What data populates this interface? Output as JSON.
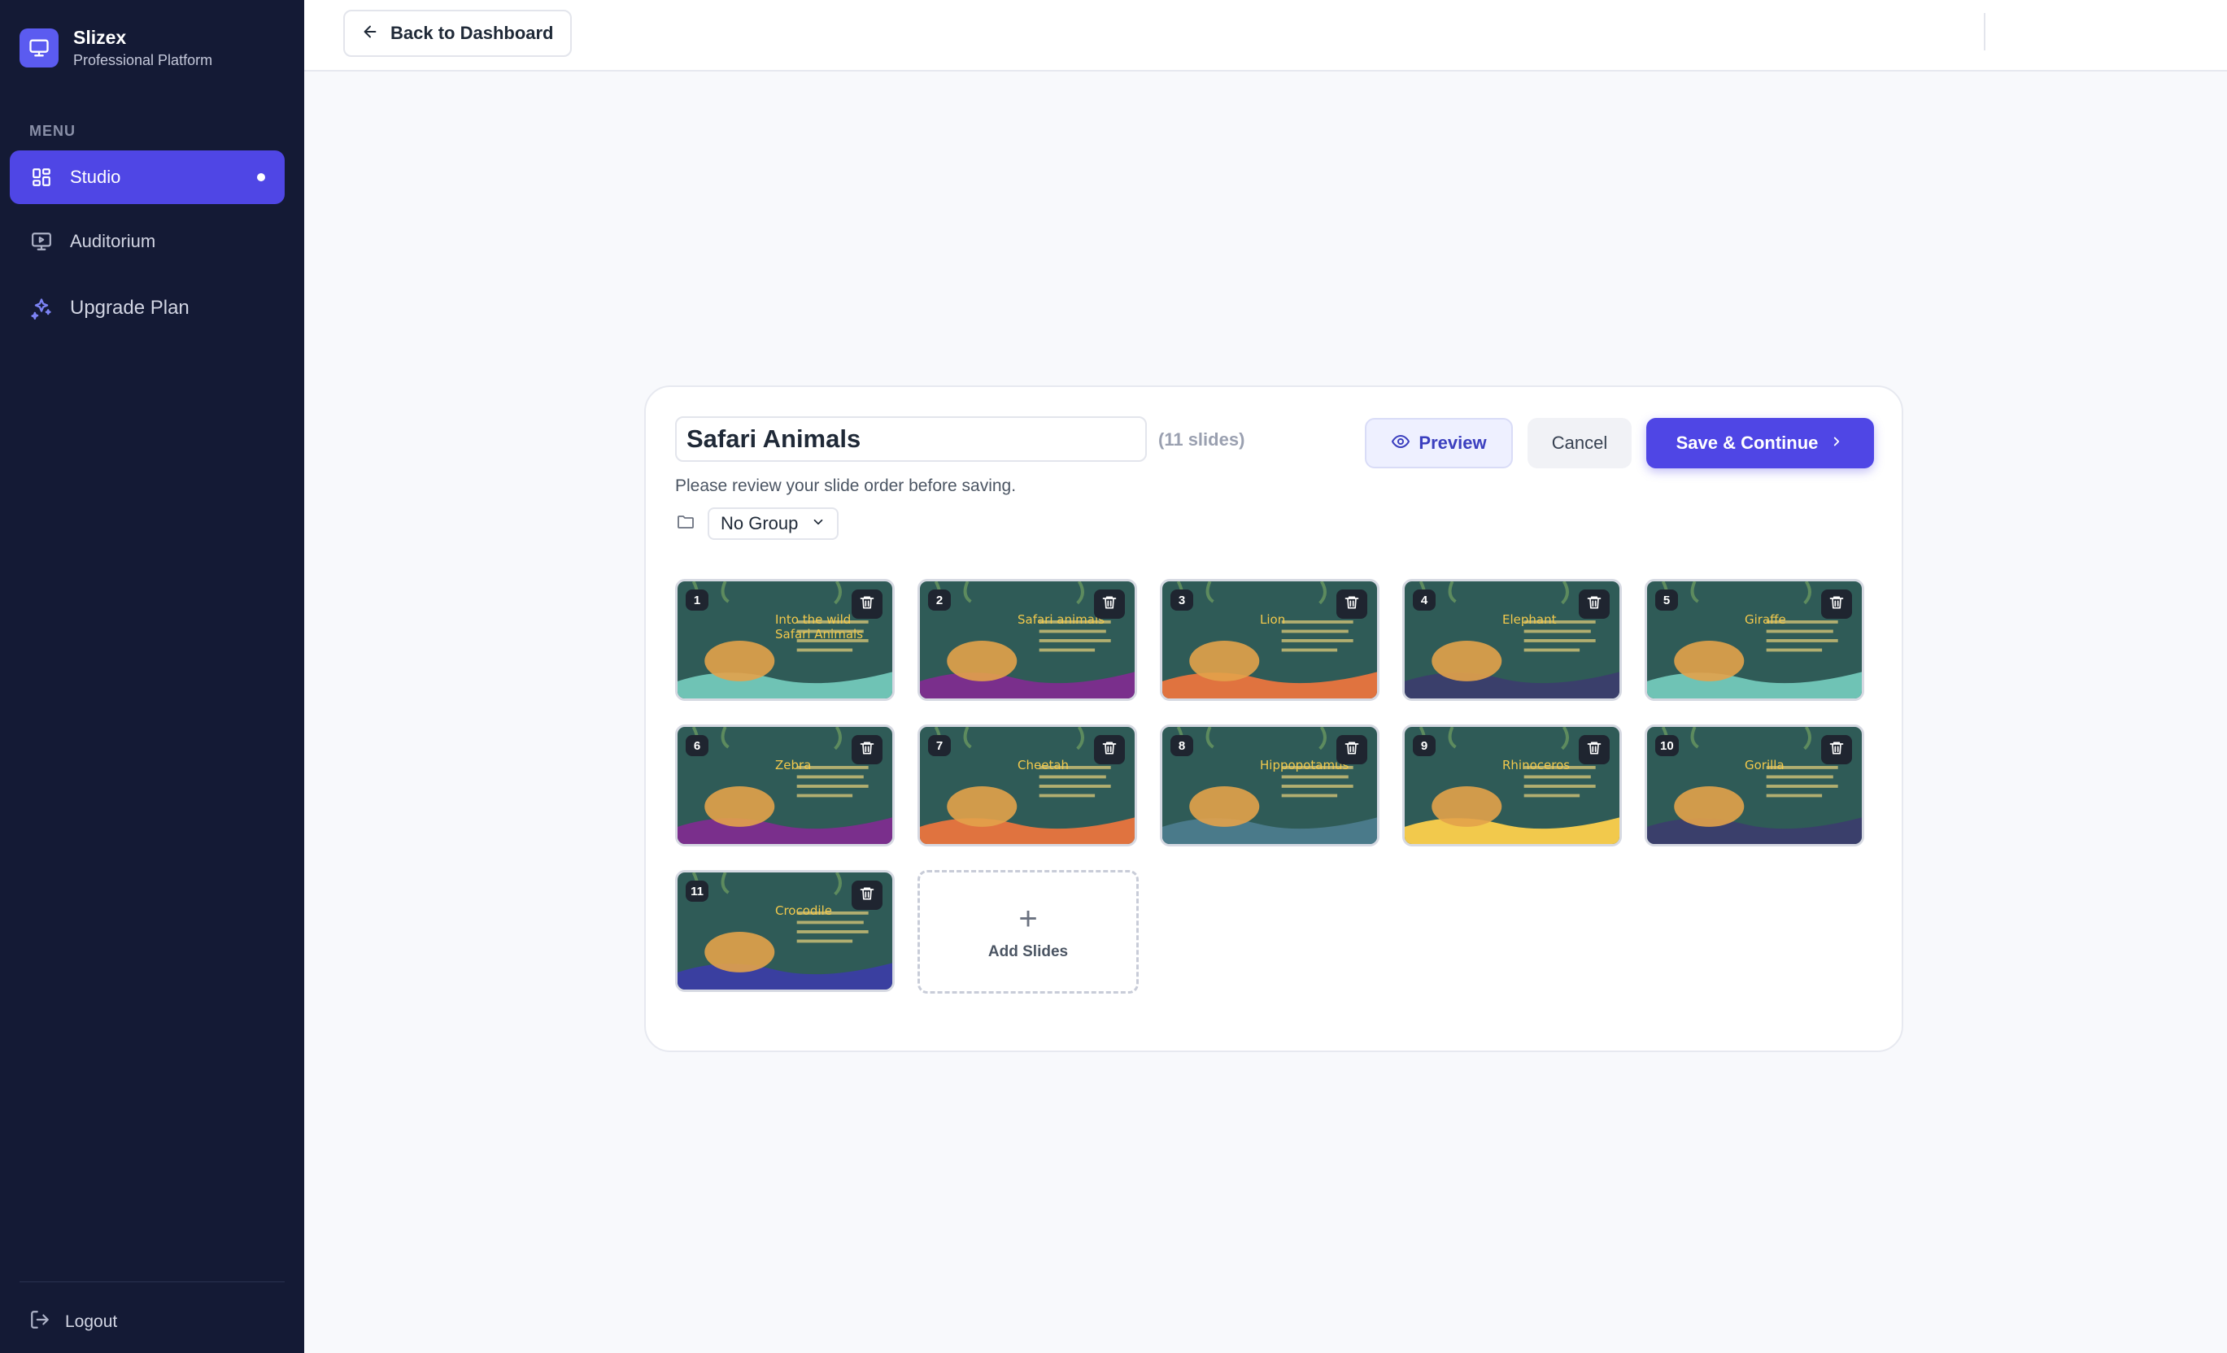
{
  "brand": {
    "name": "Slizex",
    "subtitle": "Professional Platform"
  },
  "sidebar": {
    "menu_label": "MENU",
    "items": [
      {
        "label": "Studio",
        "icon": "layout-grid-icon",
        "active": true
      },
      {
        "label": "Auditorium",
        "icon": "monitor-play-icon",
        "active": false
      },
      {
        "label": "Upgrade Plan",
        "icon": "sparkles-icon",
        "active": false
      }
    ],
    "logout_label": "Logout"
  },
  "topbar": {
    "back_label": "Back to Dashboard"
  },
  "editor": {
    "title_value": "Safari Animals",
    "slide_count": "(11 slides)",
    "subtitle": "Please review your slide order before saving.",
    "group_value": "No Group",
    "preview_label": "Preview",
    "cancel_label": "Cancel",
    "save_label": "Save & Continue",
    "add_slides_label": "Add Slides"
  },
  "slides": [
    {
      "number": "1",
      "title": "Into the wild\nSafari Animals",
      "bg": "#2f5b57",
      "ground": "#6fc3b5"
    },
    {
      "number": "2",
      "title": "Safari animals",
      "bg": "#2f5b57",
      "ground": "#7a2f8c"
    },
    {
      "number": "3",
      "title": "Lion",
      "bg": "#2f5b57",
      "ground": "#e0733f"
    },
    {
      "number": "4",
      "title": "Elephant",
      "bg": "#2f5b57",
      "ground": "#3a3f6b"
    },
    {
      "number": "5",
      "title": "Giraffe",
      "bg": "#2f5b57",
      "ground": "#6fc3b5"
    },
    {
      "number": "6",
      "title": "Zebra",
      "bg": "#2f5b57",
      "ground": "#7a2f8c"
    },
    {
      "number": "7",
      "title": "Cheetah",
      "bg": "#2f5b57",
      "ground": "#e0733f"
    },
    {
      "number": "8",
      "title": "Hippopotamus",
      "bg": "#2f5b57",
      "ground": "#4a7a8a"
    },
    {
      "number": "9",
      "title": "Rhinoceros",
      "bg": "#2f5b57",
      "ground": "#f2c94c"
    },
    {
      "number": "10",
      "title": "Gorilla",
      "bg": "#2f5b57",
      "ground": "#3a3f6b"
    },
    {
      "number": "11",
      "title": "Crocodile",
      "bg": "#2f5b57",
      "ground": "#3a3fa0"
    }
  ],
  "colors": {
    "accent": "#4f46e5",
    "sidebar_bg": "#141a35"
  }
}
